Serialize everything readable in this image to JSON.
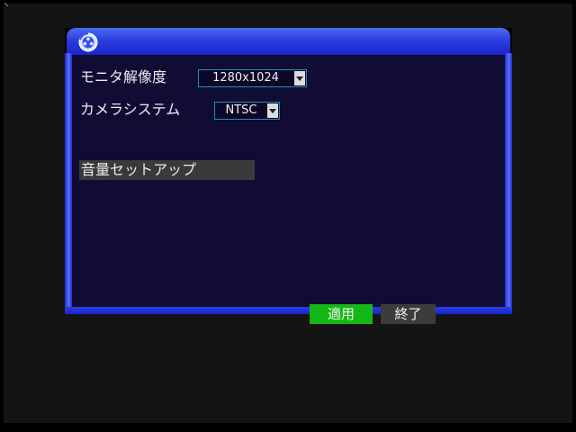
{
  "dialog": {
    "title_icon": "film-reel-icon",
    "monitor_resolution": {
      "label": "モニタ解像度",
      "value": "1280x1024"
    },
    "camera_system": {
      "label": "カメラシステム",
      "value": "NTSC"
    },
    "volume_setup": {
      "label": "音量セットアップ"
    },
    "buttons": {
      "apply": "適用",
      "exit": "終了"
    }
  },
  "colors": {
    "titlebar": "#2a3ee0",
    "content_bg": "#100c34",
    "apply_bg": "#14b814",
    "exit_bg": "#3c3c3c",
    "select_border": "#2a8ab0"
  }
}
